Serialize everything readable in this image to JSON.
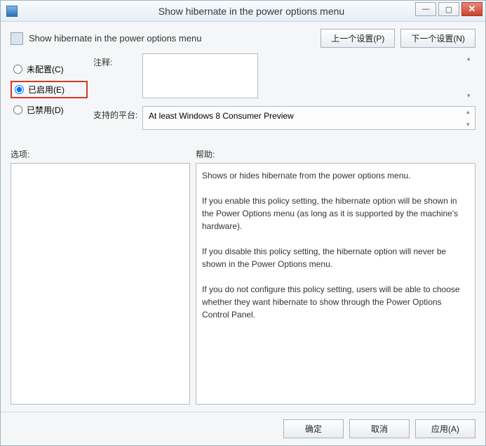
{
  "window": {
    "title": "Show hibernate in the power options menu"
  },
  "header": {
    "policy_title": "Show hibernate in the power options menu",
    "prev_btn": "上一个设置(P)",
    "next_btn": "下一个设置(N)"
  },
  "radios": {
    "not_configured": "未配置(C)",
    "enabled": "已启用(E)",
    "disabled": "已禁用(D)",
    "selected": "enabled"
  },
  "fields": {
    "comment_label": "注释:",
    "comment_value": "",
    "platform_label": "支持的平台:",
    "platform_value": "At least Windows 8 Consumer Preview"
  },
  "sections": {
    "options_label": "选项:",
    "help_label": "帮助:"
  },
  "help_text": "Shows or hides hibernate from the power options menu.\n\nIf you enable this policy setting, the hibernate option will be shown in the Power Options menu (as long as it is supported by the machine's hardware).\n\nIf you disable this policy setting, the hibernate option will never be shown in the Power Options menu.\n\nIf you do not configure this policy setting, users will be able to choose whether they want hibernate to show through the Power Options Control Panel.",
  "footer": {
    "ok": "确定",
    "cancel": "取消",
    "apply": "应用(A)"
  },
  "icons": {
    "minimize": "—",
    "maximize": "▢",
    "close": "✕",
    "scroll_up": "▴",
    "scroll_down": "▾"
  }
}
